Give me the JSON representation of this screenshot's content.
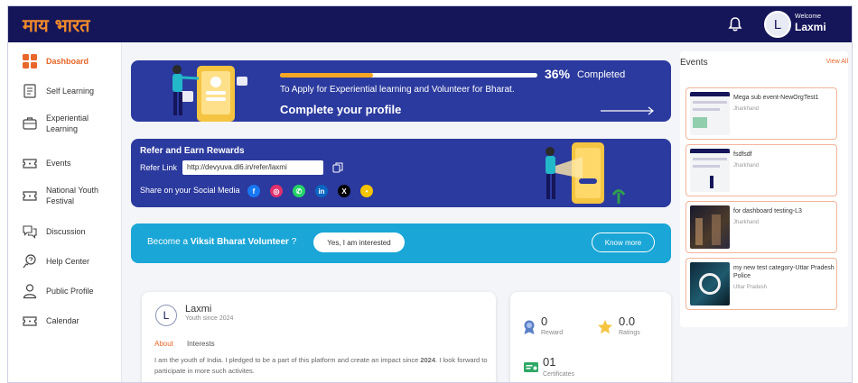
{
  "header": {
    "logo_text": "माय भारत",
    "welcome_label": "Welcome",
    "user_name": "Laxmi",
    "avatar_initial": "L"
  },
  "sidebar": {
    "items": [
      {
        "label": "Dashboard",
        "icon": "dashboard-icon",
        "active": true
      },
      {
        "label": "Self Learning",
        "icon": "book-icon"
      },
      {
        "label": "Experiential Learning",
        "icon": "briefcase-icon"
      },
      {
        "label": "Events",
        "icon": "ticket-icon"
      },
      {
        "label": "National Youth Festival",
        "icon": "ticket-icon"
      },
      {
        "label": "Discussion",
        "icon": "chat-icon"
      },
      {
        "label": "Help Center",
        "icon": "help-icon"
      },
      {
        "label": "Public Profile",
        "icon": "user-icon"
      },
      {
        "label": "Calendar",
        "icon": "calendar-icon"
      }
    ]
  },
  "profile_banner": {
    "progress_value": "36%",
    "progress_fraction": 0.36,
    "progress_label": "Completed",
    "subtitle": "To Apply for Experiential learning and Volunteer for Bharat.",
    "cta": "Complete your profile"
  },
  "refer": {
    "title": "Refer and Earn Rewards",
    "link_label": "Refer Link",
    "link_value": "http://devyuva.dl6.in/refer/laxmi",
    "share_label": "Share on your Social Media",
    "socials": [
      {
        "name": "facebook-icon",
        "color": "#1877f2",
        "glyph": "f"
      },
      {
        "name": "instagram-icon",
        "color": "#e1306c",
        "glyph": "◎"
      },
      {
        "name": "whatsapp-icon",
        "color": "#25d366",
        "glyph": "✆"
      },
      {
        "name": "linkedin-icon",
        "color": "#0a66c2",
        "glyph": "in"
      },
      {
        "name": "x-icon",
        "color": "#000000",
        "glyph": "X"
      },
      {
        "name": "koo-icon",
        "color": "#f5c400",
        "glyph": "•"
      }
    ]
  },
  "volunteer": {
    "prefix": "Become a ",
    "highlight": "Viksit Bharat Volunteer",
    "suffix": " ?",
    "yes_button": "Yes, I am interested",
    "know_button": "Know more"
  },
  "user_card": {
    "initial": "L",
    "name": "Laxmi",
    "since": "Youth since 2024",
    "tabs": [
      "About",
      "Interests"
    ],
    "bio_prefix": "I am the youth of India. I pledged to be a part of this platform and create an impact since ",
    "bio_year": "2024",
    "bio_suffix": ". I look forward to participate in more such activites."
  },
  "stats": {
    "reward_value": "0",
    "reward_label": "Reward",
    "ratings_value": "0.0",
    "ratings_label": "Ratings",
    "certificates_value": "01",
    "certificates_label": "Certificates"
  },
  "events": {
    "title": "Events",
    "view_all": "View All",
    "items": [
      {
        "title": "Mega sub event-NewOrgTest1",
        "location": "Jharkhand"
      },
      {
        "title": "fsdfsdf",
        "location": "Jharkhand"
      },
      {
        "title": "for dashboard testing-L3",
        "location": "Jharkhand"
      },
      {
        "title": "my new test category-Uttar Pradesh Police",
        "location": "Uttar Pradesh"
      }
    ]
  },
  "colors": {
    "navy": "#15155a",
    "banner_blue": "#2b3a9e",
    "volunteer_cyan": "#1aa6d6",
    "accent_orange": "#e8672a",
    "progress_orange": "#f5a623"
  }
}
